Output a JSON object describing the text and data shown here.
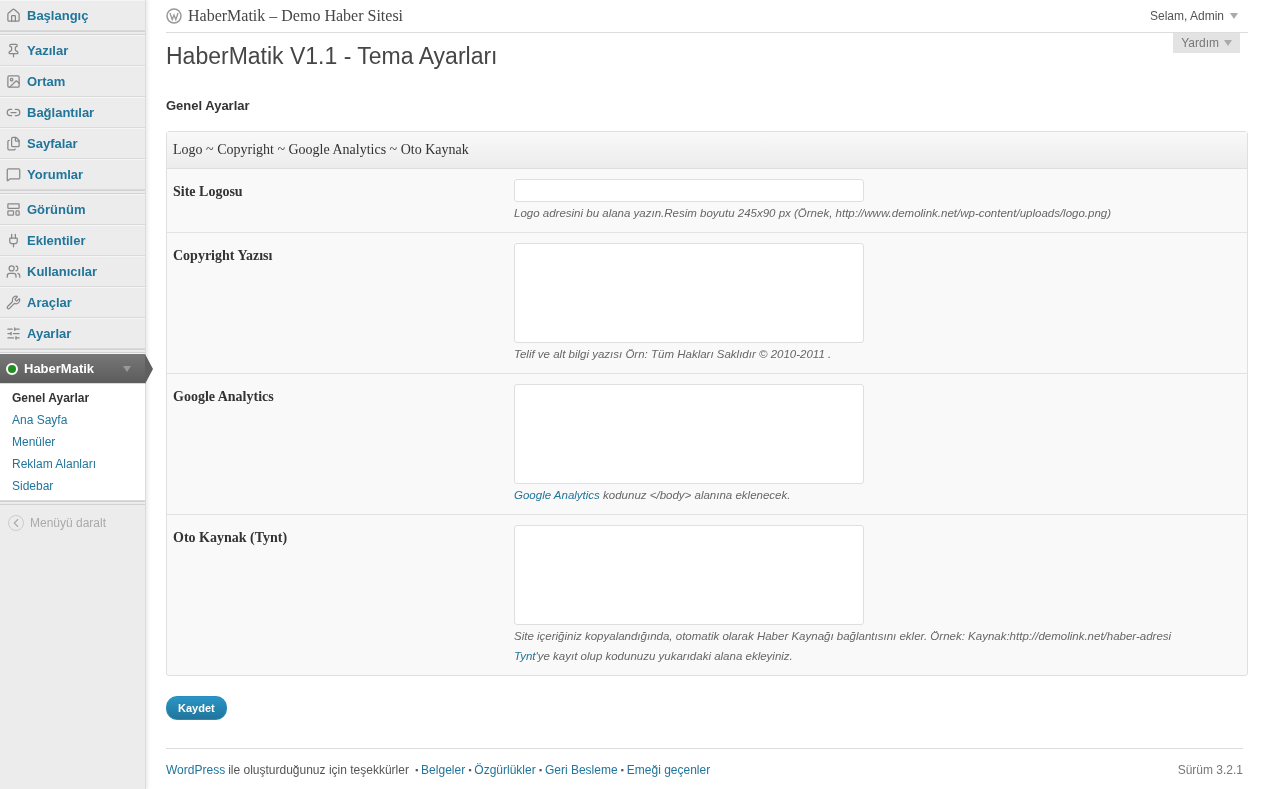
{
  "sidebar": {
    "groups": [
      [
        {
          "label": "Başlangıç",
          "selected": false
        }
      ],
      [
        {
          "label": "Yazılar",
          "selected": false
        },
        {
          "label": "Ortam",
          "selected": false
        },
        {
          "label": "Bağlantılar",
          "selected": false
        },
        {
          "label": "Sayfalar",
          "selected": false
        },
        {
          "label": "Yorumlar",
          "selected": false
        }
      ],
      [
        {
          "label": "Görünüm",
          "selected": false
        },
        {
          "label": "Eklentiler",
          "selected": false
        },
        {
          "label": "Kullanıcılar",
          "selected": false
        },
        {
          "label": "Araçlar",
          "selected": false
        },
        {
          "label": "Ayarlar",
          "selected": false
        }
      ],
      [
        {
          "label": "HaberMatik",
          "selected": true,
          "expanded": true,
          "children": [
            {
              "label": "Genel Ayarlar",
              "selected": true
            },
            {
              "label": "Ana Sayfa",
              "selected": false
            },
            {
              "label": "Menüler",
              "selected": false
            },
            {
              "label": "Reklam Alanları",
              "selected": false
            },
            {
              "label": "Sidebar",
              "selected": false
            }
          ]
        }
      ]
    ],
    "collapse": "Menüyü daralt"
  },
  "header": {
    "site_title": "HaberMatik – Demo Haber Sitesi",
    "user": "Selam, Admin",
    "help": "Yardım"
  },
  "page_title": "HaberMatik V1.1 - Tema Ayarları",
  "section_title": "Genel Ayarlar",
  "panel": {
    "title": "Logo ~ Copyright ~ Google Analytics ~ Oto Kaynak",
    "rows": [
      {
        "label": "Site Logosu",
        "kind": "input",
        "help": [
          [
            {
              "text": "Logo adresini bu alana yazın.Resim boyutu 245x90 px (Örnek, http://www.demolink.net/wp-content/uploads/logo.png)",
              "link": false
            }
          ]
        ]
      },
      {
        "label": "Copyright Yazısı",
        "kind": "textarea",
        "help": [
          [
            {
              "text": "Telif ve alt bilgi yazısı Örn: Tüm Hakları Saklıdır © 2010-2011 .",
              "link": false
            }
          ]
        ]
      },
      {
        "label": "Google Analytics",
        "kind": "textarea",
        "help": [
          [
            {
              "text": "Google Analytics",
              "link": true
            },
            {
              "text": "kodunuz </body> alanına eklenecek.",
              "link": false
            }
          ]
        ]
      },
      {
        "label": "Oto Kaynak (Tynt)",
        "kind": "textarea",
        "help": [
          [
            {
              "text": "Site içeriğiniz kopyalandığında, otomatik olarak Haber Kaynağı bağlantısını ekler. Örnek: Kaynak:http://demolink.net/haber-adresi",
              "link": false
            }
          ],
          [
            {
              "text": "Tynt",
              "link": true
            },
            {
              "text": "'ye kayıt olup kodunuzu yukarıdaki alana ekleyiniz.",
              "link": false
            }
          ]
        ]
      }
    ]
  },
  "save_button": "Kaydet",
  "footer": {
    "items": [
      {
        "text": "WordPress",
        "kind": "link"
      },
      {
        "text": "ile oluşturduğunuz için teşekkürler",
        "kind": "text"
      },
      {
        "text": "▪",
        "kind": "bullet"
      },
      {
        "text": "Belgeler",
        "kind": "link"
      },
      {
        "text": "▪",
        "kind": "bullet"
      },
      {
        "text": "Özgürlükler",
        "kind": "link"
      },
      {
        "text": "▪",
        "kind": "bullet"
      },
      {
        "text": "Geri Besleme",
        "kind": "link"
      },
      {
        "text": "▪",
        "kind": "bullet"
      },
      {
        "text": "Emeği geçenler",
        "kind": "link"
      }
    ],
    "version": "Sürüm 3.2.1"
  }
}
